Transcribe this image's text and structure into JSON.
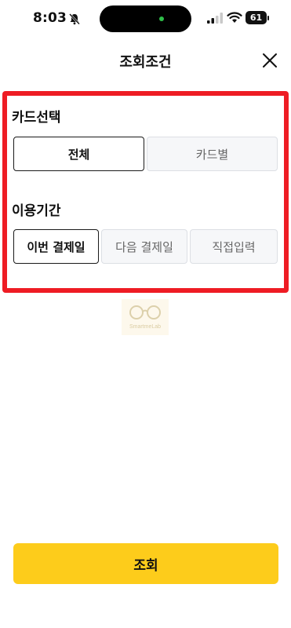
{
  "status_bar": {
    "time": "8:03",
    "battery": "61"
  },
  "header": {
    "title": "조회조건"
  },
  "card_select": {
    "label": "카드선택",
    "options": [
      {
        "label": "전체",
        "selected": true
      },
      {
        "label": "카드별",
        "selected": false
      }
    ]
  },
  "period": {
    "label": "이용기간",
    "options": [
      {
        "label": "이번 결제일",
        "selected": true
      },
      {
        "label": "다음 결제일",
        "selected": false
      },
      {
        "label": "직접입력",
        "selected": false
      }
    ]
  },
  "watermark": {
    "text": "SmartmeLab"
  },
  "footer": {
    "submit_label": "조회"
  },
  "colors": {
    "highlight": "#ee1c24",
    "accent": "#fdcc1b"
  }
}
